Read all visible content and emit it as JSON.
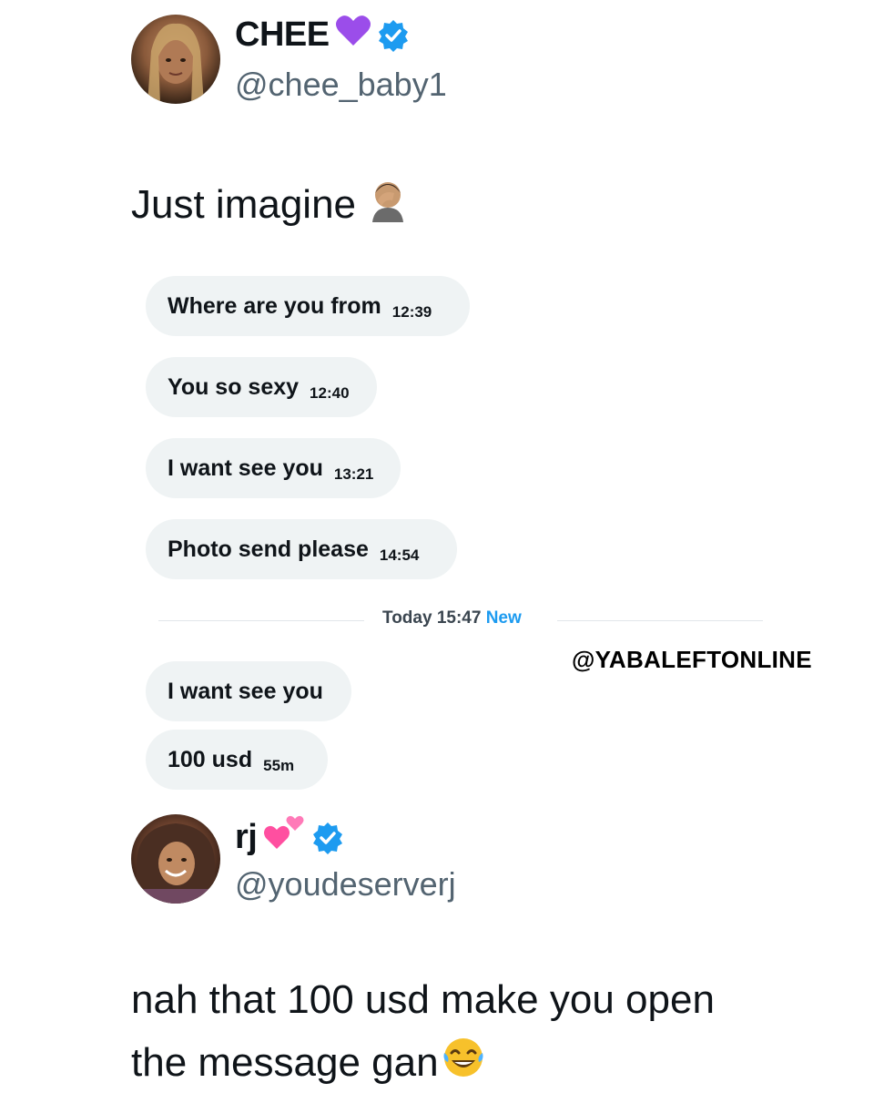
{
  "tweet1": {
    "display_name": "CHEE",
    "handle": "@chee_baby1",
    "text": "Just imagine"
  },
  "messages": [
    {
      "text": "Where are you from",
      "time": "12:39"
    },
    {
      "text": "You so sexy",
      "time": "12:40"
    },
    {
      "text": "I want see you",
      "time": "13:21"
    },
    {
      "text": "Photo send please",
      "time": "14:54"
    }
  ],
  "divider": {
    "label": "Today 15:47",
    "new_label": "New"
  },
  "new_messages": [
    {
      "text": "I want see you",
      "time": ""
    },
    {
      "text": "100 usd",
      "time": "55m"
    }
  ],
  "watermark": "@YABALEFTONLINE",
  "tweet2": {
    "display_name": "rj",
    "handle": "@youdeserverj",
    "text_line1": "nah that 100 usd make you open",
    "text_line2": "the message gan"
  },
  "colors": {
    "verified": "#1d9bf0",
    "purple_heart": "#9b4dea",
    "pink_hearts": "#ff4fa0",
    "bubble": "#eff3f4"
  },
  "icons": [
    "purple-heart-icon",
    "verified-badge-icon",
    "facepalm-emoji-icon",
    "two-hearts-icon",
    "laughing-tears-emoji-icon"
  ]
}
